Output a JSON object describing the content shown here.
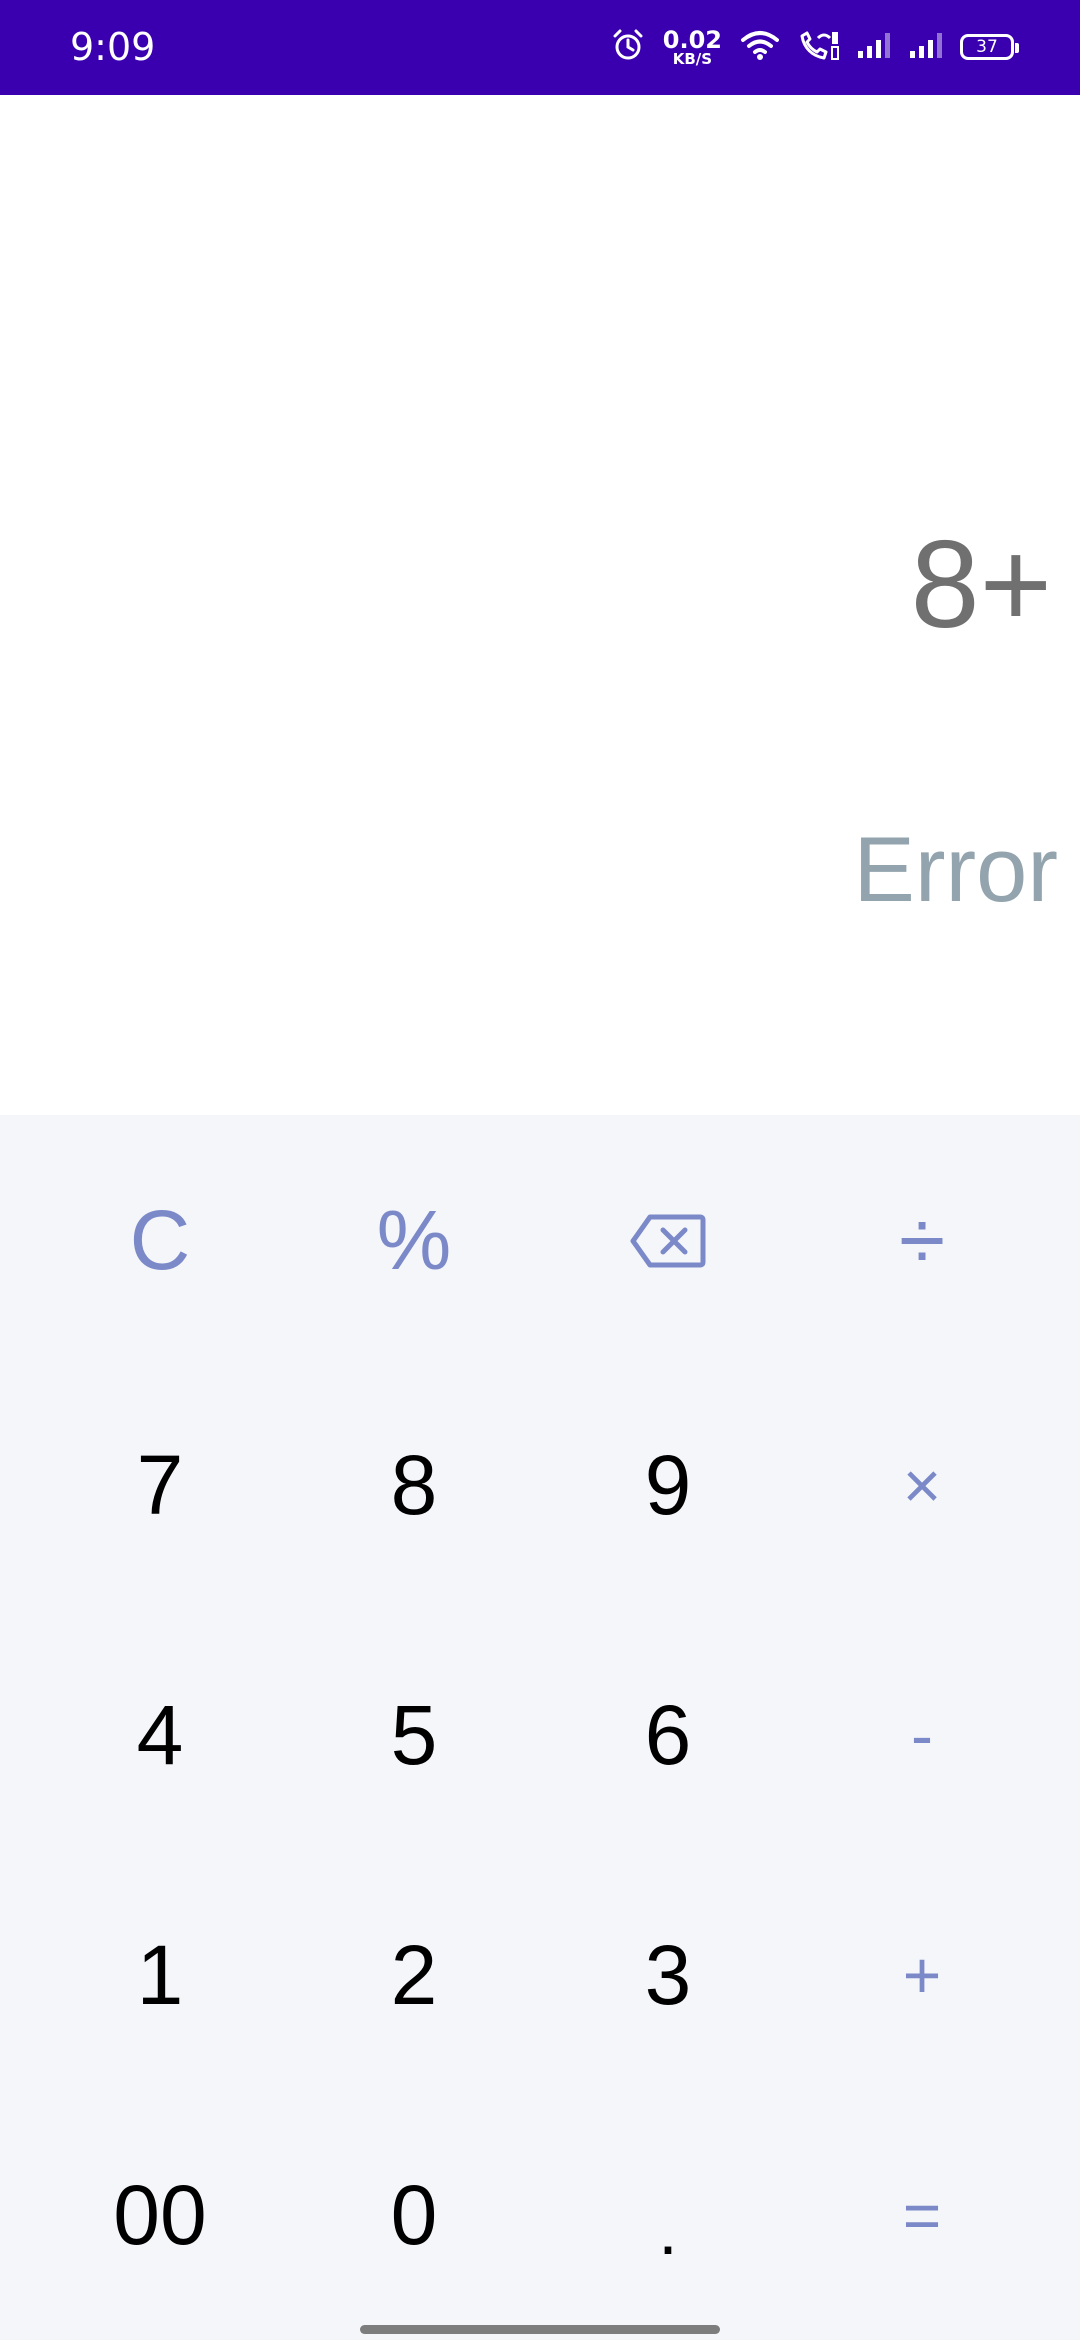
{
  "status_bar": {
    "time": "9:09",
    "net_speed_value": "0.02",
    "net_speed_unit": "KB/S",
    "battery_level": "37",
    "icons": [
      "alarm-icon",
      "wifi-icon",
      "wifi-call-icon",
      "signal-1-icon",
      "signal-2-icon",
      "battery-icon"
    ],
    "background_color": "#3a00b0"
  },
  "display": {
    "expression": "8+",
    "result": "Error"
  },
  "keypad": {
    "clear": "C",
    "percent": "%",
    "backspace_icon": "backspace-icon",
    "divide": "÷",
    "seven": "7",
    "eight": "8",
    "nine": "9",
    "multiply": "×",
    "four": "4",
    "five": "5",
    "six": "6",
    "minus": "-",
    "one": "1",
    "two": "2",
    "three": "3",
    "plus": "+",
    "double_zero": "00",
    "zero": "0",
    "decimal": ".",
    "equals": "=",
    "accent_color": "#7b89c9"
  }
}
